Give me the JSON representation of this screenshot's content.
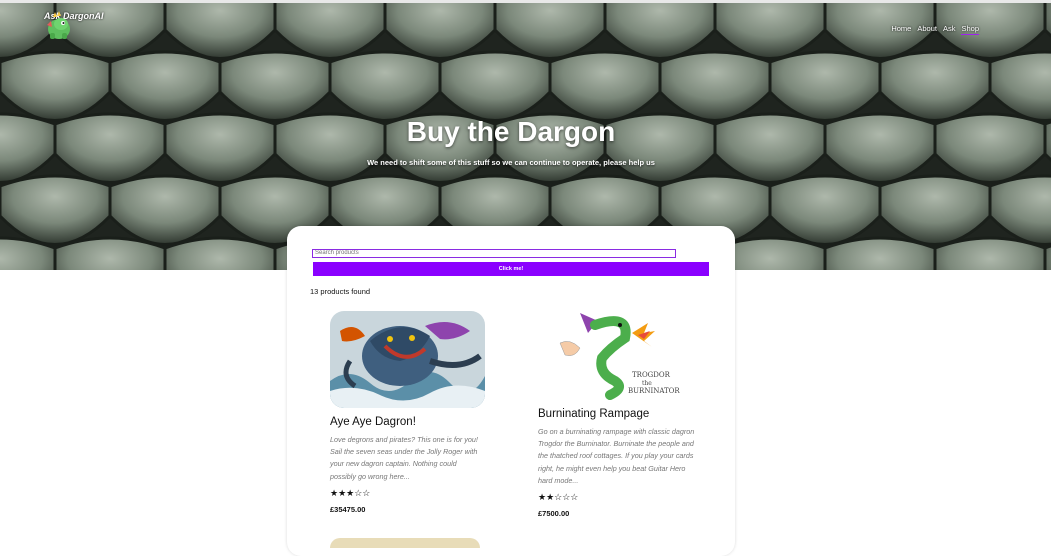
{
  "brand": {
    "name": "Ask DargonAI",
    "logo_icon": "dragon-logo-icon"
  },
  "nav": {
    "items": [
      "Home",
      "About",
      "Ask",
      "Shop"
    ],
    "active": "Shop"
  },
  "hero": {
    "title": "Buy the Dargon",
    "subtitle": "We need to shift some of this stuff so we can continue to operate, please help us"
  },
  "search": {
    "placeholder": "Search products",
    "value": ""
  },
  "button": {
    "label": "Click me!"
  },
  "results": {
    "count_text": "13 products found"
  },
  "products": [
    {
      "name": "Aye Aye Dagron!",
      "description": "Love degrons and pirates? This one is for you! Sail the seven seas under the Jolly Roger with your new dagron captain. Nothing could possibly go wrong here...",
      "stars": "★★★☆☆",
      "rating": 3,
      "price": "£35475.00"
    },
    {
      "name": "Burninating Rampage",
      "description": "Go on a burninating rampage with classic dagron Trogdor the Burninator. Burninate the people and the thatched roof cottages. If you play your cards right, he might even help you beat Guitar Hero hard mode...",
      "stars": "★★☆☆☆",
      "rating": 2,
      "price": "£7500.00",
      "image_text": [
        "TROGDOR",
        "the",
        "BURNINATOR"
      ]
    }
  ],
  "colors": {
    "accent": "#8a00ff",
    "hero": "#5c6a5c"
  }
}
